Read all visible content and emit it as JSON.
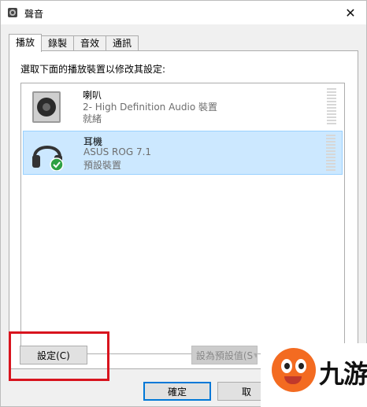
{
  "window": {
    "title": "聲音",
    "close_label": "✕"
  },
  "tabs": [
    {
      "label": "播放",
      "active": true
    },
    {
      "label": "錄製",
      "active": false
    },
    {
      "label": "音效",
      "active": false
    },
    {
      "label": "通訊",
      "active": false
    }
  ],
  "instruction": "選取下面的播放裝置以修改其設定:",
  "devices": [
    {
      "name": "喇叭",
      "description": "2- High Definition Audio 裝置",
      "status": "就緒",
      "icon": "speaker-icon",
      "selected": false
    },
    {
      "name": "耳機",
      "description": "ASUS ROG 7.1",
      "status": "預設裝置",
      "icon": "headphones-icon",
      "selected": true,
      "default": true
    }
  ],
  "buttons": {
    "configure": "設定(C)",
    "set_default": "設為預設值(S",
    "ok": "確定",
    "cancel": "取"
  },
  "watermark_logo": {
    "text": "九游"
  },
  "colors": {
    "selection": "#cce8ff",
    "highlight_box": "#d8141e",
    "ok_border": "#0078d7",
    "default_check": "#2ea043"
  }
}
